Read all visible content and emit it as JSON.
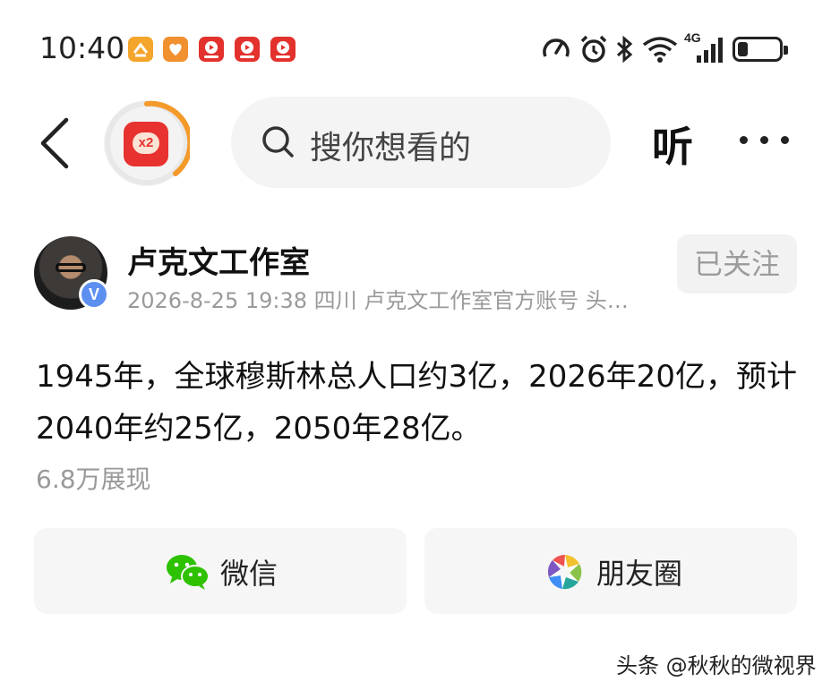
{
  "status_bar": {
    "time": "10:40",
    "notification_icons": [
      "memo-app-icon",
      "heart-app-icon",
      "video-app-icon",
      "video-app-icon",
      "video-app-icon"
    ],
    "system_icons": [
      "speedometer-icon",
      "alarm-icon",
      "bluetooth-icon",
      "wifi-icon",
      "4g-signal-icon",
      "battery-icon"
    ],
    "network_label": "4G",
    "battery_level": 0.25
  },
  "header": {
    "back_icon": "chevron-left-icon",
    "task_badge_label": "x2",
    "search_placeholder": "搜你想看的",
    "listen_label": "听",
    "more_icon": "more-dots-icon"
  },
  "author": {
    "name": "卢克文工作室",
    "meta": "2026-8-25 19:38 四川 卢克文工作室官方账号 头…",
    "verified_label": "V",
    "follow_label": "已关注"
  },
  "post": {
    "text": "1945年，全球穆斯林总人口约3亿，2026年20亿，预计2040年约25亿，2050年28亿。",
    "views": "6.8万展现"
  },
  "share": {
    "wechat_label": "微信",
    "moments_label": "朋友圈"
  },
  "watermark": "头条 @秋秋的微视界",
  "colors": {
    "accent_red": "#e8322f",
    "ring_orange": "#f39a2b",
    "verified_blue": "#5d8ff0",
    "wechat_green": "#2dc100"
  }
}
